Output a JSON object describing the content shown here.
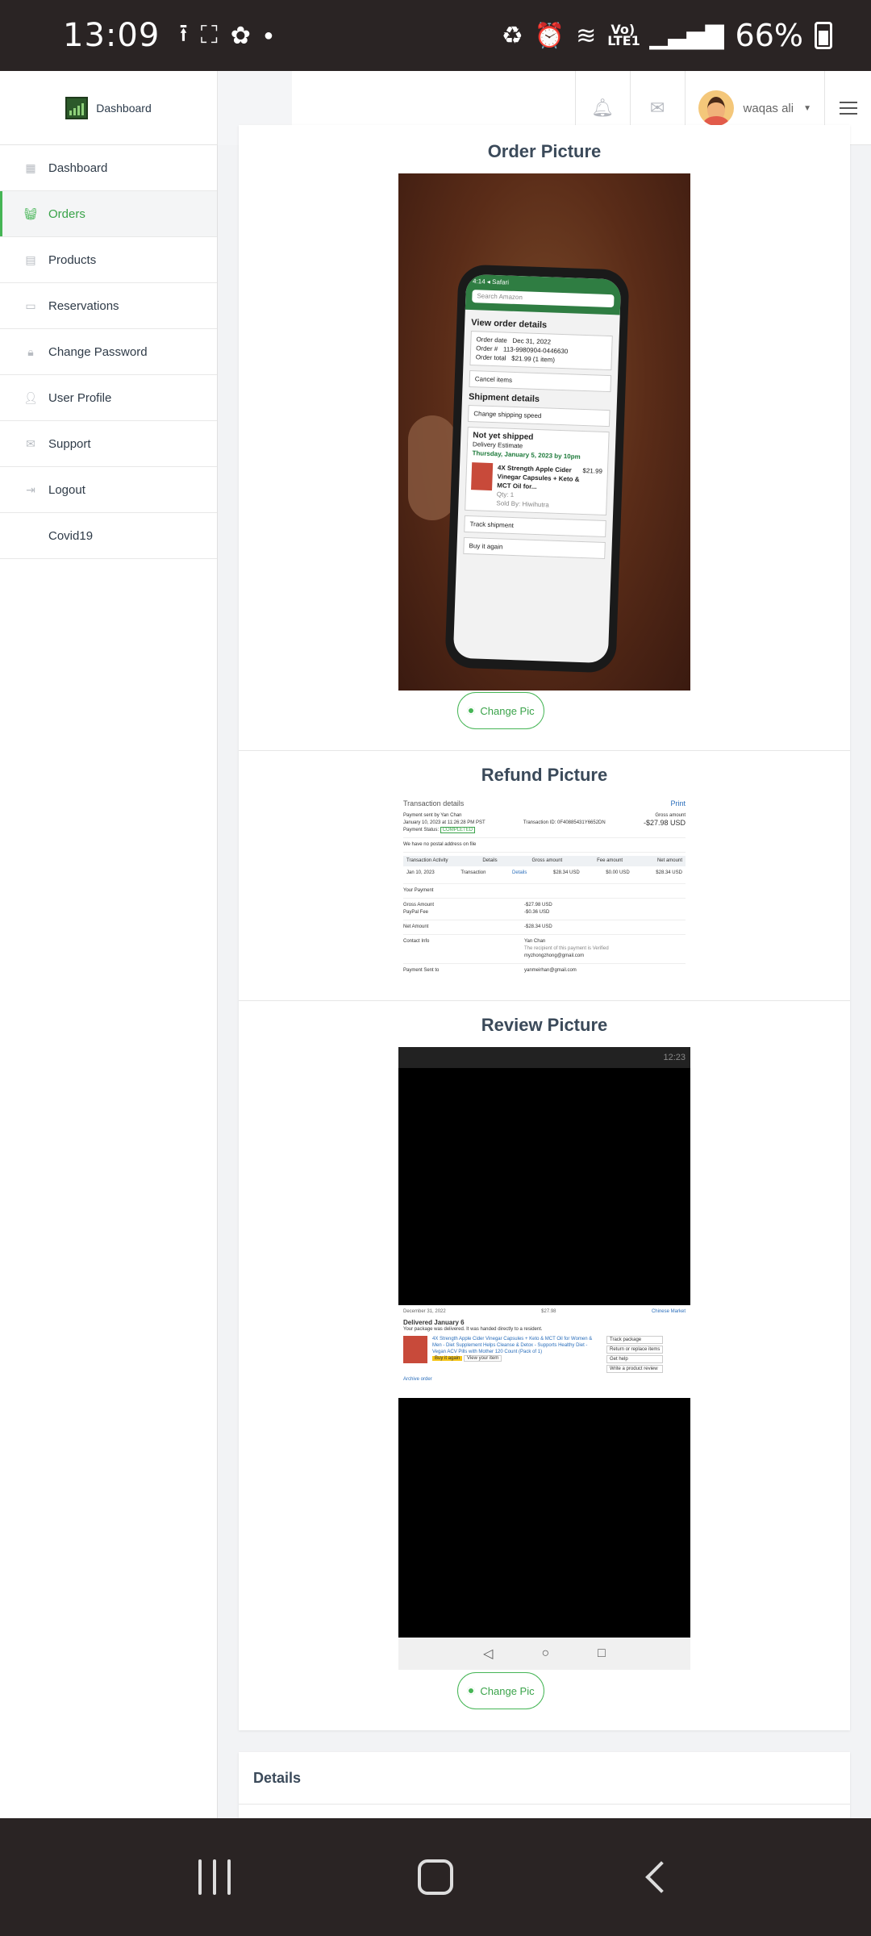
{
  "status_bar": {
    "time": "13:09",
    "network": "Vo) LTE1",
    "battery": "66%"
  },
  "header": {
    "brand": "Dashboard",
    "user_name": "waqas ali"
  },
  "sidebar": {
    "items": [
      {
        "label": "Dashboard",
        "icon": "table-icon"
      },
      {
        "label": "Orders",
        "icon": "basket-icon"
      },
      {
        "label": "Products",
        "icon": "file-icon"
      },
      {
        "label": "Reservations",
        "icon": "id-card-icon"
      },
      {
        "label": "Change Password",
        "icon": "lock-icon"
      },
      {
        "label": "User Profile",
        "icon": "user-icon"
      },
      {
        "label": "Support",
        "icon": "envelope-icon"
      },
      {
        "label": "Logout",
        "icon": "sign-out-icon"
      },
      {
        "label": "Covid19",
        "icon": ""
      }
    ]
  },
  "main": {
    "order_title": "Order Picture",
    "refund_title": "Refund Picture",
    "review_title": "Review Picture",
    "change_pic_label": "Change Pic",
    "details_title": "Details"
  },
  "order_photo": {
    "time": "4:14",
    "app": "Safari",
    "search": "Search Amazon",
    "heading": "View order details",
    "order_date_label": "Order date",
    "order_date": "Dec 31, 2022",
    "order_no_label": "Order #",
    "order_no": "113-9980904-0446630",
    "order_total_label": "Order total",
    "order_total": "$21.99 (1 item)",
    "cancel": "Cancel items",
    "shipment_heading": "Shipment details",
    "change_speed": "Change shipping speed",
    "status": "Not yet shipped",
    "delivery_label": "Delivery Estimate",
    "delivery_date": "Thursday, January 5, 2023 by 10pm",
    "product": "4X Strength Apple Cider Vinegar Capsules + Keto & MCT Oil for...",
    "price": "$21.99",
    "qty": "Qty: 1",
    "sold_by": "Sold By: Hiwihutra",
    "track": "Track shipment",
    "buy_again": "Buy it again"
  },
  "refund_shot": {
    "title": "Transaction details",
    "print": "Print",
    "sent_by": "Payment sent by Yan Chan",
    "date": "January 10, 2023 at 11:26:28 PM PST",
    "transaction_id": "Transaction ID: 0F40885431Y6652DN",
    "gross_label": "Gross amount",
    "gross": "-$27.98 USD",
    "payment_status": "Payment Status:",
    "status_value": "COMPLETED",
    "no_address": "We have no postal address on file",
    "activity": "Transaction Activity",
    "col_details": "Details",
    "col_gross": "Gross amount",
    "col_fee": "Fee amount",
    "col_net": "Net amount",
    "row_date": "Jan 10, 2023",
    "row_type": "Transaction",
    "row_details": "Details",
    "row_gross": "$28.34 USD",
    "row_fee": "$0.00 USD",
    "row_net": "$28.34 USD",
    "your_payment": "Your Payment",
    "gross_amount_label": "Gross Amount",
    "gross_amount": "-$27.98 USD",
    "paypal_fee_label": "PayPal Fee",
    "paypal_fee": "-$0.36 USD",
    "net_amount_label": "Net Amount",
    "net_amount": "-$28.34 USD",
    "contact_label": "Contact Info",
    "contact_name": "Yan Chan",
    "verified_text": "The recipient of this payment is Verified",
    "contact_email": "myzhongzhong@gmail.com",
    "sent_to_label": "Payment Sent to",
    "sent_to": "yanmeirhan@gmail.com"
  },
  "review_shot": {
    "time": "12:23",
    "order_placed": "December 31, 2022",
    "total": "$27.98",
    "ship_to": "Chinese Market",
    "delivered": "Delivered January 6",
    "delivered_note": "Your package was delivered. It was handed directly to a resident.",
    "product": "4X Strength Apple Cider Vinegar Capsules + Keto & MCT Oil for Women & Men - Diet Supplement Helps Cleanse & Detox - Supports Healthy Diet - Vegan ACV Pills with Mother 120 Count (Pack of 1)",
    "buy_again": "Buy it again",
    "view_item": "View your item",
    "track": "Track package",
    "return": "Return or replace items",
    "help": "Get help",
    "write_review": "Write a product review",
    "archive": "Archive order"
  }
}
